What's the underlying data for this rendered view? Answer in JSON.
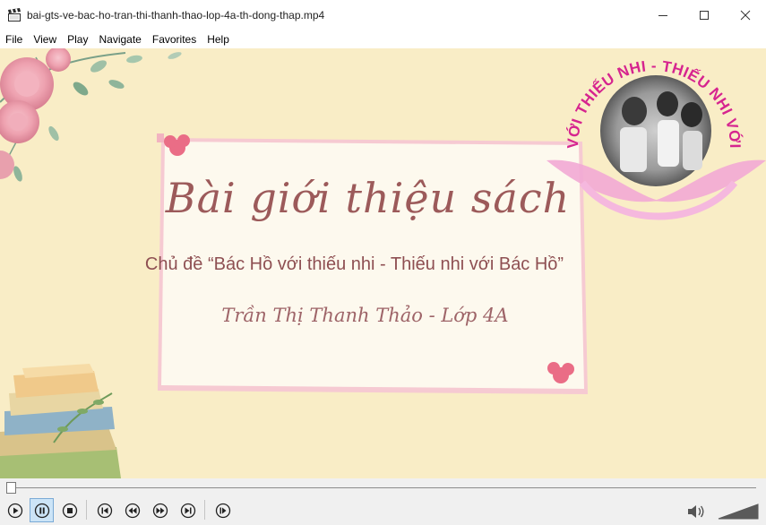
{
  "window": {
    "title": "bai-gts-ve-bac-ho-tran-thi-thanh-thao-lop-4a-th-dong-thap.mp4",
    "app_icon": "film-clapper-icon",
    "controls": [
      "minimize-icon",
      "maximize-icon",
      "close-icon"
    ]
  },
  "menu": {
    "items": [
      "File",
      "View",
      "Play",
      "Navigate",
      "Favorites",
      "Help"
    ]
  },
  "slide": {
    "title": "Bài giới thiệu sách",
    "topic": "Chủ đề “Bác Hồ với thiếu nhi - Thiếu nhi với Bác Hồ”",
    "author": "Trần Thị Thanh Thảo - Lớp 4A",
    "badge_text": "BÁC HỒ VỚI THIẾU NHI - THIẾU NHI VỚI BÁC HỒ",
    "colors": {
      "background": "#f9edc6",
      "card": "#fdf9ee",
      "accent_pink": "#e8657e",
      "text_brown": "#9c5a5a",
      "badge_magenta": "#d6248f"
    }
  },
  "player": {
    "position_fraction": 0.0,
    "volume_fraction": 1.0,
    "buttons": [
      "play-icon",
      "pause-icon",
      "stop-icon",
      "skip-back-icon",
      "rewind-icon",
      "fast-forward-icon",
      "skip-forward-icon",
      "frame-step-icon"
    ],
    "active_button": "pause"
  }
}
